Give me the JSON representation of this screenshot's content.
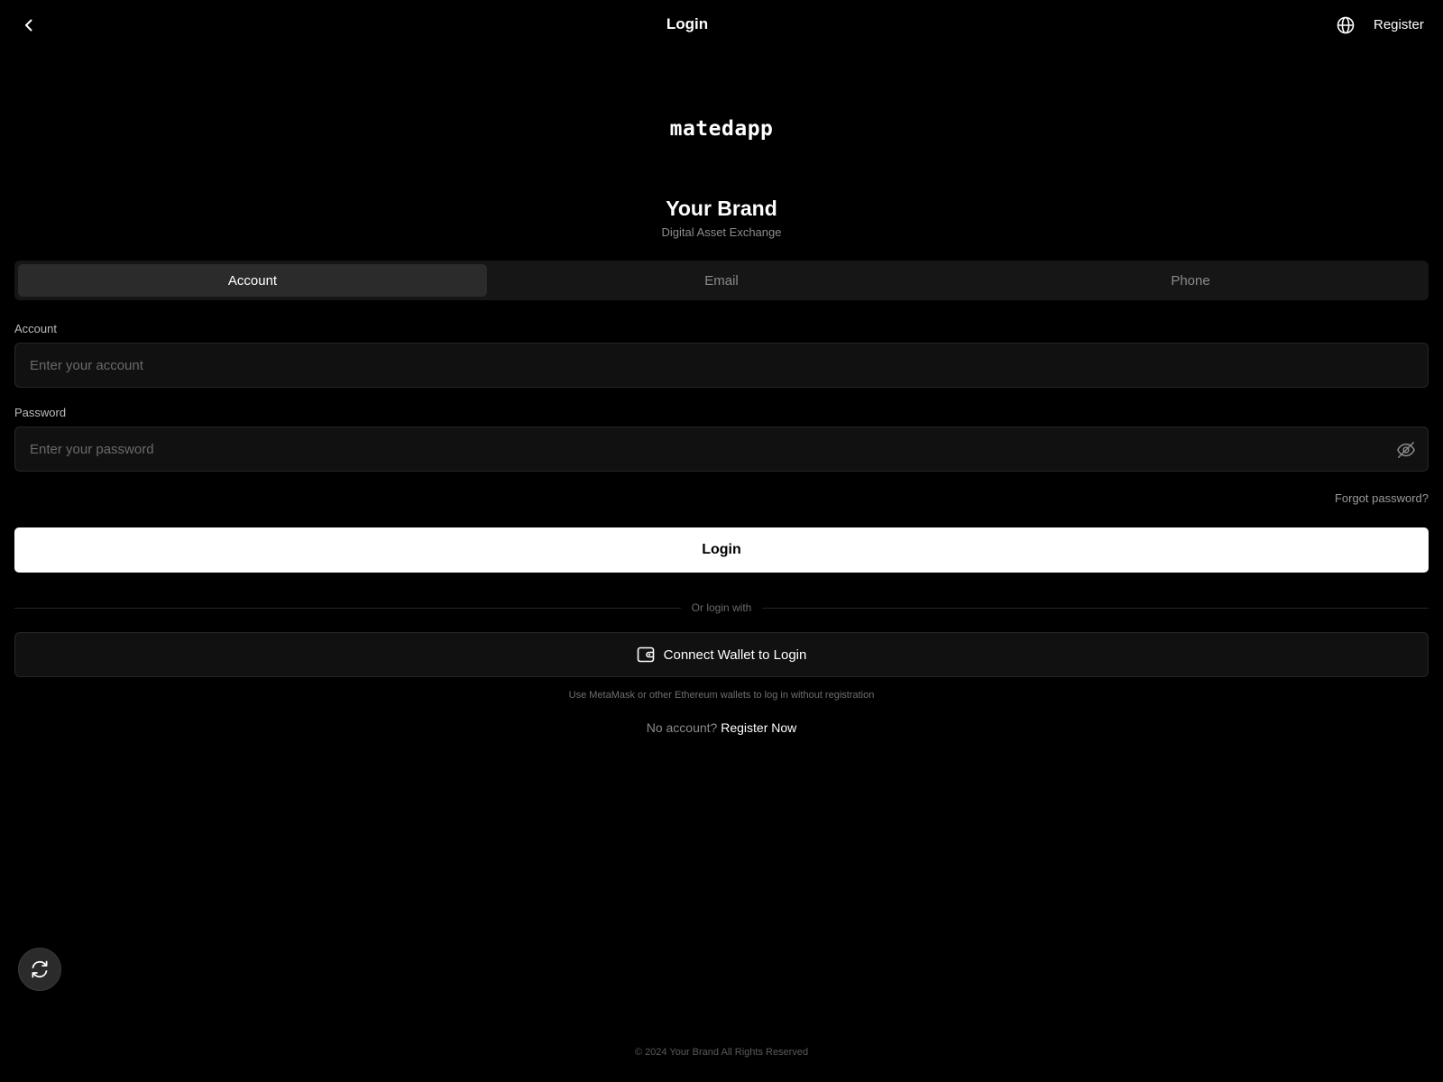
{
  "header": {
    "title": "Login",
    "register_label": "Register",
    "back_icon": "chevron-left-icon",
    "language_icon": "globe-icon"
  },
  "brand": {
    "logo_text": "matedapp",
    "name": "Your Brand",
    "subtitle": "Digital Asset Exchange"
  },
  "tabs": [
    {
      "label": "Account",
      "active": true
    },
    {
      "label": "Email",
      "active": false
    },
    {
      "label": "Phone",
      "active": false
    }
  ],
  "form": {
    "account": {
      "label": "Account",
      "placeholder": "Enter your account",
      "value": ""
    },
    "password": {
      "label": "Password",
      "placeholder": "Enter your password",
      "value": "",
      "toggle_icon": "eye-off-icon"
    },
    "forgot_label": "Forgot password?",
    "login_label": "Login"
  },
  "alt_login": {
    "divider_text": "Or login with",
    "wallet_label": "Connect Wallet to Login",
    "wallet_icon": "wallet-icon",
    "wallet_hint": "Use MetaMask or other Ethereum wallets to log in without registration"
  },
  "signup": {
    "prompt": "No account?",
    "link_label": "Register Now"
  },
  "fab": {
    "icon": "refresh-icon"
  },
  "footer": {
    "copyright": "© 2024 Your Brand All Rights Reserved"
  },
  "colors": {
    "background": "#000000",
    "surface": "#111111",
    "tab_active": "#2b2b2b",
    "primary_button": "#ffffff",
    "muted_text": "#8a8a8a"
  }
}
